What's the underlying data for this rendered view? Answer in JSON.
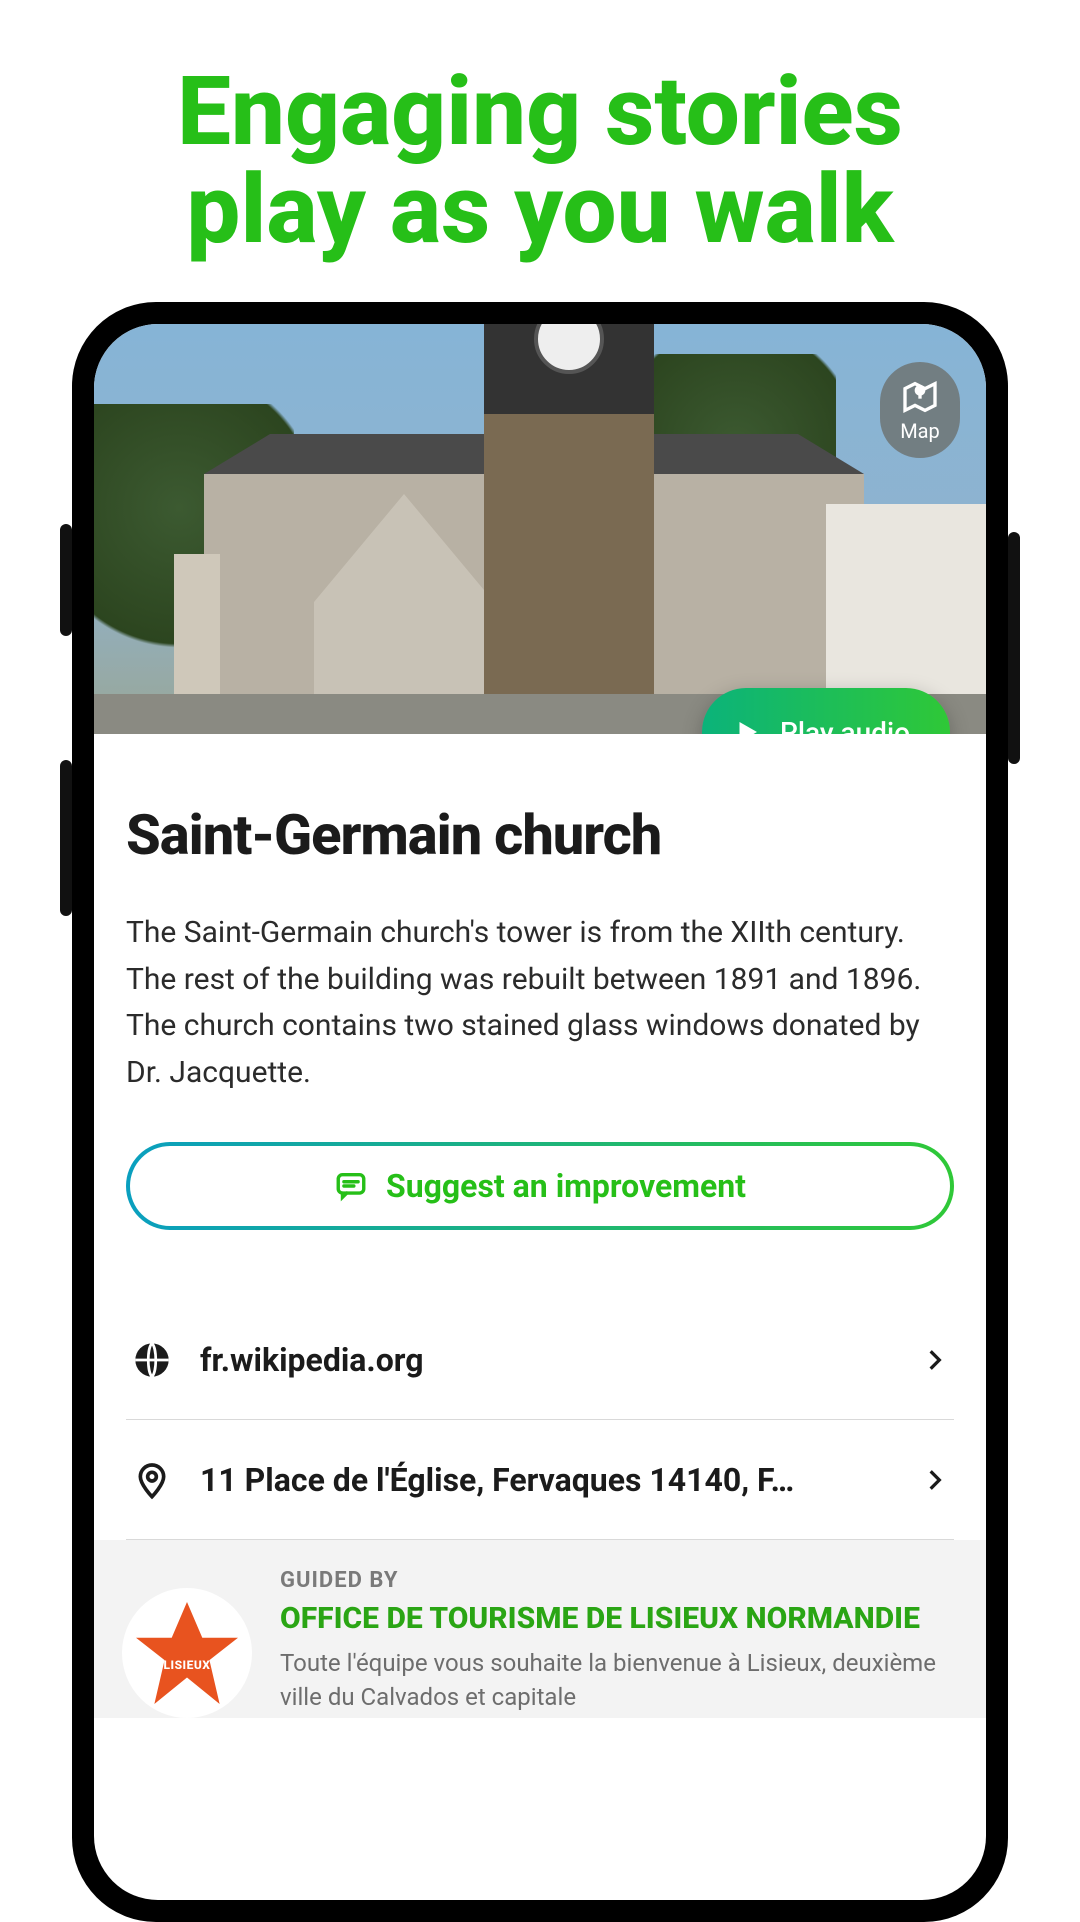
{
  "headline": {
    "line1": "Engaging stories",
    "line2": "play as you walk"
  },
  "map_button": {
    "label": "Map"
  },
  "play_button": {
    "label": "Play audio"
  },
  "poi": {
    "title": "Saint-Germain church",
    "description": "The Saint-Germain church's tower is from the XIIth century. The rest of the building was rebuilt between 1891 and 1896. The church contains two stained glass windows donated by Dr. Jacquette."
  },
  "suggest_button": {
    "label": "Suggest an improvement"
  },
  "links": {
    "website": "fr.wikipedia.org",
    "address": "11 Place de l'Église, Fervaques 14140, F…"
  },
  "guide": {
    "eyebrow": "GUIDED BY",
    "name": "OFFICE DE TOURISME DE LISIEUX NORMANDIE",
    "description": "Toute l'équipe vous souhaite la bienvenue à Lisieux, deuxième ville du Calvados et capitale",
    "logo_text": "LISIEUX"
  }
}
